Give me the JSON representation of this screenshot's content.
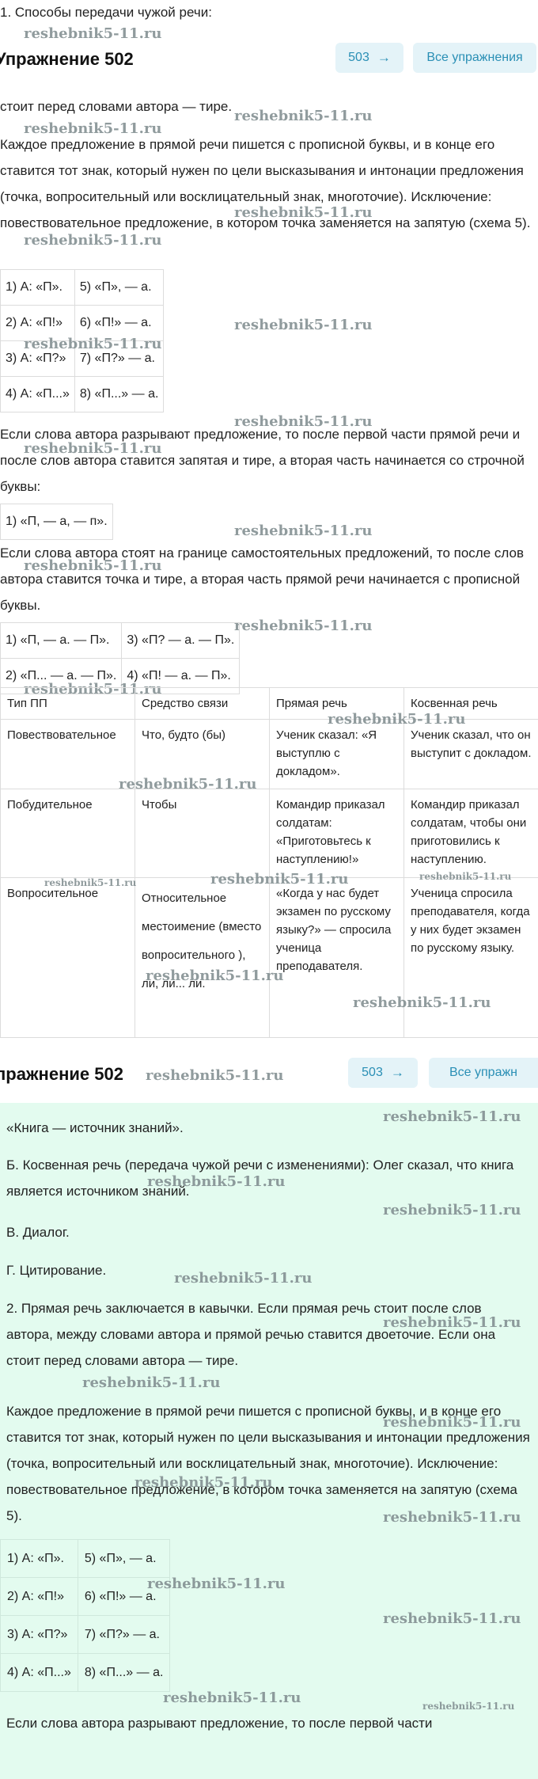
{
  "top_line": "1. Способы передачи чужой речи:",
  "header1": {
    "title": "Упражнение 502",
    "next_label": "503",
    "all_label": "Все упражнения"
  },
  "header2": {
    "title": "пражнение 502",
    "next_label": "503",
    "all_label": "Все упражн"
  },
  "watermark": "reshebnik5-11.ru",
  "p1": "стоит перед словами автора — тире.",
  "p2": "Каждое предложение в прямой речи пишется с прописной буквы, и в конце его ставится тот знак, который нужен по цели высказывания и интонации предложения (точка, вопросительный или восклицательный знак, многоточие). Исключение: повествовательное предложение, в котором точка заменяется на запятую (схема 5).",
  "schemes": [
    [
      "1) А: «П».",
      "5) «П», — а."
    ],
    [
      "2) А: «П!»",
      "6) «П!» — а."
    ],
    [
      "3) А: «П?»",
      "7) «П?» — а."
    ],
    [
      "4) А: «П...»",
      "8) «П...» — а."
    ]
  ],
  "p3": "Если слова автора разрывают предложение, то после первой части прямой речи и после слов автора ставится запятая и тире, а вторая часть начинается со строчной буквы:",
  "scheme_break": "1) «П, — а, — п».",
  "p4": "Если слова автора стоят на границе самостоятельных предложений, то после слов автора ставится точка и тире, а вторая часть прямой речи начинается с прописной буквы.",
  "schemes2": [
    [
      "1) «П, — а. — П».",
      "3) «П? — а. — П»."
    ],
    [
      "2) «П... — а. — П».",
      "4) «П! — а. — П»."
    ]
  ],
  "table": {
    "headers": [
      "Тип ПП",
      "Средство связи",
      "Прямая речь",
      "Косвенная речь"
    ],
    "rows": [
      [
        "Повествовательное",
        "Что, будто (бы)",
        "Ученик сказал: «Я выступлю с докладом».",
        "Ученик сказал, что он выступит с докладом."
      ],
      [
        "Побудительное",
        "Чтобы",
        "Командир приказал солдатам: «Приготовьтесь к наступлению!»",
        "Командир приказал солдатам, чтобы они приготовились к наступлению."
      ],
      [
        "Вопросительное",
        "Относительное местоимение (вместо вопросительного ), ли, ли... ли.",
        "«Когда у нас будет экзамен по русскому языку?» — спросила ученица преподавателя.",
        "Ученица спросила преподавателя, когда у них будет экзамен по русскому языку."
      ]
    ]
  },
  "g": {
    "quote": "«Книга — источник знаний».",
    "b": "Б. Косвенная речь (передача чужой речи с изменениями): Олег сказал, что книга является источником знаний.",
    "v": "В. Диалог.",
    "gc": "Г. Цитирование.",
    "p2": "2. Прямая речь заключается в кавычки. Если прямая речь стоит после слов автора, между словами автора и прямой речью ставится двоеточие. Если она стоит перед словами автора — тире.",
    "p3": "Каждое предложение в прямой речи пишется с прописной буквы, и в конце его ставится тот знак, который нужен по цели высказывания и интонации предложения (точка, вопросительный или восклицательный знак, многоточие). Исключение: повествовательное предложение, в котором точка заменяется на запятую (схема 5).",
    "schemes": [
      [
        "1) А: «П».",
        "5) «П», — а."
      ],
      [
        "2) А: «П!»",
        "6) «П!» — а."
      ],
      [
        "3) А: «П?»",
        "7) «П?» — а."
      ],
      [
        "4) А: «П...»",
        "8) «П...» — а."
      ]
    ],
    "p4": "Если слова автора разрывают предложение, то после первой части"
  },
  "colors": {
    "accent": "#2a8fb5",
    "button_bg": "#e4f3f8",
    "green_bg": "#e3fbef"
  }
}
